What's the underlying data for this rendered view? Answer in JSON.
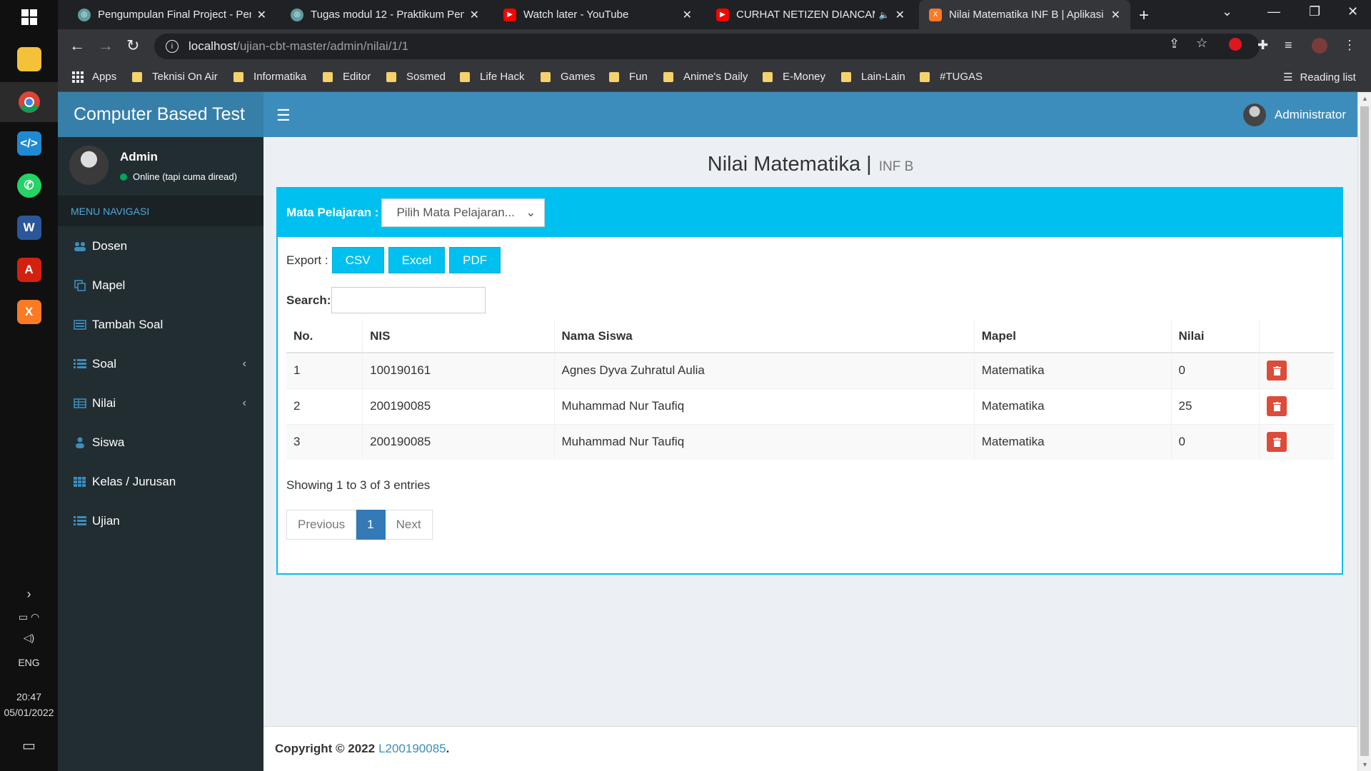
{
  "taskbar": {
    "lang": "ENG",
    "time": "20:47",
    "date": "05/01/2022"
  },
  "browser": {
    "tabs": [
      {
        "title": "Pengumpulan Final Project - Pem",
        "icon": "globe-icon",
        "color": "#5f9ea0"
      },
      {
        "title": "Tugas modul 12 - Praktikum Pem",
        "icon": "globe-icon",
        "color": "#5f9ea0"
      },
      {
        "title": "Watch later - YouTube",
        "icon": "youtube-icon",
        "color": "#ff0000"
      },
      {
        "title": "CURHAT NETIZEN DIANCAM",
        "icon": "youtube-icon",
        "color": "#ff0000"
      },
      {
        "title": "Nilai Matematika INF B | Aplikasi",
        "icon": "xampp-icon",
        "color": "#fb7a24"
      }
    ],
    "url_host": "localhost",
    "url_path": "/ujian-cbt-master/admin/nilai/1/1",
    "bookmarks": [
      "Apps",
      "Teknisi On Air",
      "Informatika",
      "Editor",
      "Sosmed",
      "Life Hack",
      "Games",
      "Fun",
      "Anime's Daily",
      "E-Money",
      "Lain-Lain",
      "#TUGAS"
    ],
    "reading_list": "Reading list"
  },
  "app": {
    "logo": "Computer Based Test",
    "top_user": "Administrator",
    "user_panel": {
      "name": "Admin",
      "status": "Online (tapi cuma diread)"
    },
    "menu_header": "MENU NAVIGASI",
    "menu": [
      {
        "label": "Dosen",
        "icon": "users-icon",
        "chevron": false
      },
      {
        "label": "Mapel",
        "icon": "copy-icon",
        "chevron": false
      },
      {
        "label": "Tambah Soal",
        "icon": "newspaper-icon",
        "chevron": false
      },
      {
        "label": "Soal",
        "icon": "list-icon",
        "chevron": true
      },
      {
        "label": "Nilai",
        "icon": "table-icon",
        "chevron": true
      },
      {
        "label": "Siswa",
        "icon": "user-icon",
        "chevron": false
      },
      {
        "label": "Kelas / Jurusan",
        "icon": "th-icon",
        "chevron": false
      },
      {
        "label": "Ujian",
        "icon": "list-icon",
        "chevron": false
      }
    ],
    "page": {
      "title": "Nilai Matematika",
      "subtitle": "INF B"
    },
    "filter": {
      "label": "Mata Pelajaran :",
      "select_value": "Pilih Mata Pelajaran..."
    },
    "export": {
      "label": "Export :",
      "buttons": [
        "CSV",
        "Excel",
        "PDF"
      ]
    },
    "search_label": "Search:",
    "table": {
      "headers": [
        "No.",
        "NIS",
        "Nama Siswa",
        "Mapel",
        "Nilai",
        ""
      ],
      "rows": [
        {
          "no": "1",
          "nis": "100190161",
          "nama": "Agnes Dyva Zuhratul Aulia",
          "mapel": "Matematika",
          "nilai": "0"
        },
        {
          "no": "2",
          "nis": "200190085",
          "nama": "Muhammad Nur Taufiq",
          "mapel": "Matematika",
          "nilai": "25"
        },
        {
          "no": "3",
          "nis": "200190085",
          "nama": "Muhammad Nur Taufiq",
          "mapel": "Matematika",
          "nilai": "0"
        }
      ]
    },
    "showing": "Showing 1 to 3 of 3 entries",
    "pager": {
      "prev": "Previous",
      "current": "1",
      "next": "Next"
    },
    "footer": {
      "text": "Copyright © 2022",
      "link": "L200190085",
      "dot": "."
    }
  }
}
